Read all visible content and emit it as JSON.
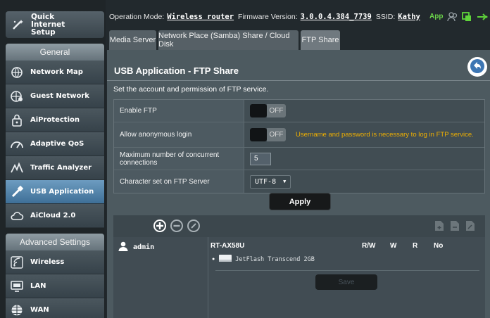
{
  "sidebar": {
    "quick_setup": "Quick Internet Setup",
    "general_label": "General",
    "general_items": [
      {
        "label": "Network Map",
        "icon": "globe-network-icon"
      },
      {
        "label": "Guest Network",
        "icon": "guest-network-icon"
      },
      {
        "label": "AiProtection",
        "icon": "lock-icon"
      },
      {
        "label": "Adaptive QoS",
        "icon": "speedometer-icon"
      },
      {
        "label": "Traffic Analyzer",
        "icon": "traffic-analyzer-icon"
      },
      {
        "label": "USB Application",
        "icon": "usb-icon"
      },
      {
        "label": "AiCloud 2.0",
        "icon": "cloud-icon"
      }
    ],
    "advanced_label": "Advanced Settings",
    "advanced_items": [
      {
        "label": "Wireless",
        "icon": "wifi-icon"
      },
      {
        "label": "LAN",
        "icon": "monitor-icon"
      },
      {
        "label": "WAN",
        "icon": "globe-icon"
      }
    ]
  },
  "topbar": {
    "mode_label": "Operation Mode:",
    "mode_value": "Wireless router",
    "firmware_label": "Firmware Version:",
    "firmware_value": "3.0.0.4.384_7739",
    "ssid_label": "SSID:",
    "ssid_value": "Kathy",
    "app_label": "App"
  },
  "tabs": [
    "Media Server",
    "Network Place (Samba) Share / Cloud Disk",
    "FTP Share"
  ],
  "main": {
    "title": "USB Application - FTP Share",
    "description": "Set the account and permission of FTP service.",
    "settings": [
      {
        "label": "Enable FTP",
        "state": "OFF"
      },
      {
        "label": "Allow anonymous login",
        "state": "OFF",
        "hint": "Username and password is necessary to log in FTP service."
      },
      {
        "label": "Maximum number of concurrent connections",
        "value": "5"
      },
      {
        "label": "Character set on FTP Server",
        "value": "UTF-8"
      }
    ],
    "apply_label": "Apply"
  },
  "table": {
    "account": "admin",
    "device": "RT-AX58U",
    "columns": [
      "R/W",
      "W",
      "R",
      "No"
    ],
    "drive": "JetFlash Transcend 2GB",
    "save_label": "Save"
  },
  "colors": {
    "accent_active": "#4f83ab",
    "hint": "#f0b000",
    "app": "#6cd44b"
  }
}
